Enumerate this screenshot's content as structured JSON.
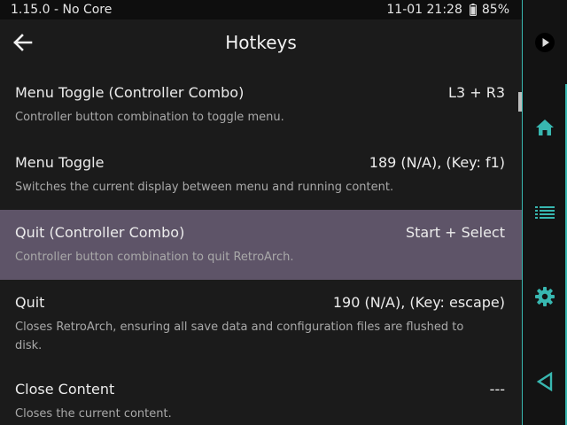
{
  "status_bar": {
    "left_text": "1.15.0 - No Core",
    "datetime": "11-01 21:28",
    "battery": "85%"
  },
  "header": {
    "title": "Hotkeys",
    "back_icon": "arrow-left-icon"
  },
  "items": [
    {
      "label": "Menu Toggle (Controller Combo)",
      "value": "L3 + R3",
      "description": "Controller button combination to toggle menu."
    },
    {
      "label": "Menu Toggle",
      "value": "189 (N/A), (Key: f1)",
      "description": "Switches the current display between menu and running content."
    },
    {
      "label": "Quit (Controller Combo)",
      "value": "Start + Select",
      "description": "Controller button combination to quit RetroArch."
    },
    {
      "label": "Quit",
      "value": "190 (N/A), (Key: escape)",
      "description": "Closes RetroArch, ensuring all save data and configuration files are flushed to disk."
    },
    {
      "label": "Close Content",
      "value": "---",
      "description": "Closes the current content."
    }
  ],
  "selected_index": 2,
  "sidebar": {
    "icons": [
      "play-circle-icon",
      "home-icon",
      "list-icon",
      "gear-icon",
      "back-triangle-icon"
    ],
    "accent_color": "#38b7b0"
  },
  "colors": {
    "background": "#1b1b1b",
    "selected_row": "#5e5468",
    "accent": "#38b7b0"
  }
}
